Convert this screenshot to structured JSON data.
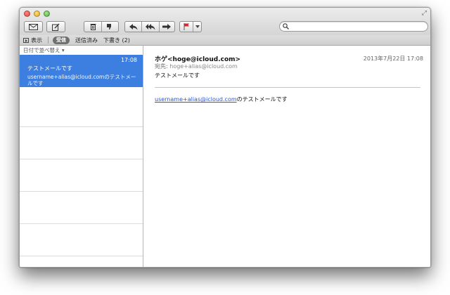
{
  "favorites": {
    "show_label": "表示",
    "inbox_label": "受信",
    "sent_label": "送信済み",
    "drafts_label": "下書き (2)"
  },
  "search": {
    "value": "",
    "placeholder": ""
  },
  "list": {
    "sort_label": "日付で並べ替え ▾",
    "items": [
      {
        "time": "17:08",
        "subject": "テストメールです",
        "preview": "username+alias@icloud.comのテストメールです"
      }
    ]
  },
  "message": {
    "from": "ホゲ<hoge@icloud.com>",
    "date": "2013年7月22日 17:08",
    "to_label": "宛先:",
    "to": "hoge+alias@icloud.com",
    "subject": "テストメールです",
    "body_link": "username+alias@icloud.com",
    "body_text": "のテストメールです"
  },
  "colors": {
    "selection": "#3d7fe0",
    "link": "#2a55d0",
    "flag": "#d9262c"
  }
}
